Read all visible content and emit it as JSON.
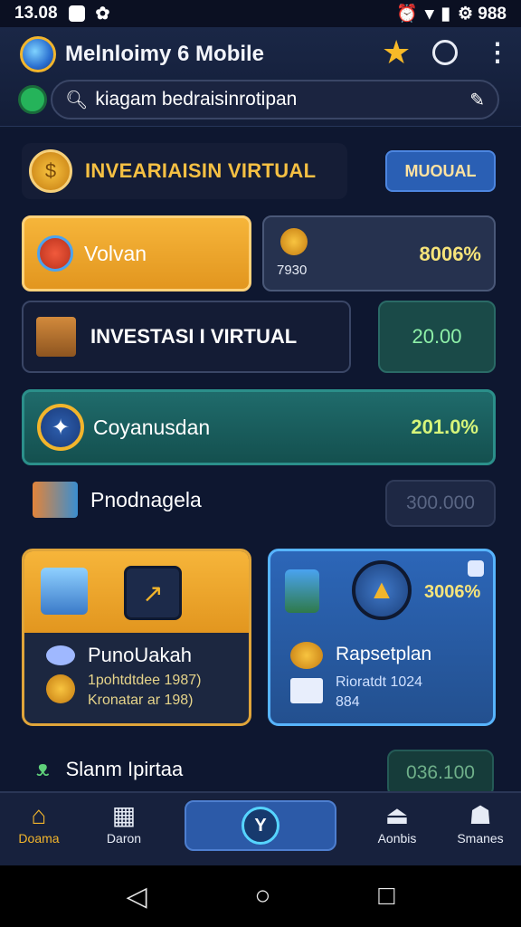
{
  "status": {
    "time": "13.08",
    "right_text": "⚙ 988"
  },
  "app": {
    "title": "Melnloimy 6 Mobile"
  },
  "search": {
    "value": "kiagam bedraisinrotipan"
  },
  "header": {
    "title": "INVEARIAISIN VIRTUAL",
    "button_label": "MUOUAL"
  },
  "cards": {
    "volvan": {
      "label": "Volvan"
    },
    "small": {
      "sub": "7930",
      "value": "8006%"
    },
    "investasi": {
      "label": "INVESTASI I VIRTUAL",
      "value": "20.00"
    },
    "coyanusdan": {
      "label": "Coyanusdan",
      "value": "201.0%"
    },
    "pnodnagela": {
      "label": "Pnodnagela",
      "value": "300.000"
    }
  },
  "panel_left": {
    "title": "PunoUakah",
    "line1": "1pohtdtdee 1987)",
    "line2": "Kronatar ar 198)"
  },
  "panel_right": {
    "pct": "3006%",
    "title": "Rapsetplan",
    "line1": "Rioratdt 1024",
    "line2": "884"
  },
  "last": {
    "label": "Slanm Ipirtaa",
    "value": "036.100"
  },
  "nav": {
    "home": "Doama",
    "second": "Daron",
    "fourth": "Aonbis",
    "fifth": "Smanes",
    "center": "Y"
  },
  "colors": {
    "accent_orange": "#f6b53a",
    "accent_blue": "#2a5fb4",
    "accent_teal": "#1f6b6b",
    "gold_text": "#f5c043",
    "value_green": "#8ef0a8"
  }
}
